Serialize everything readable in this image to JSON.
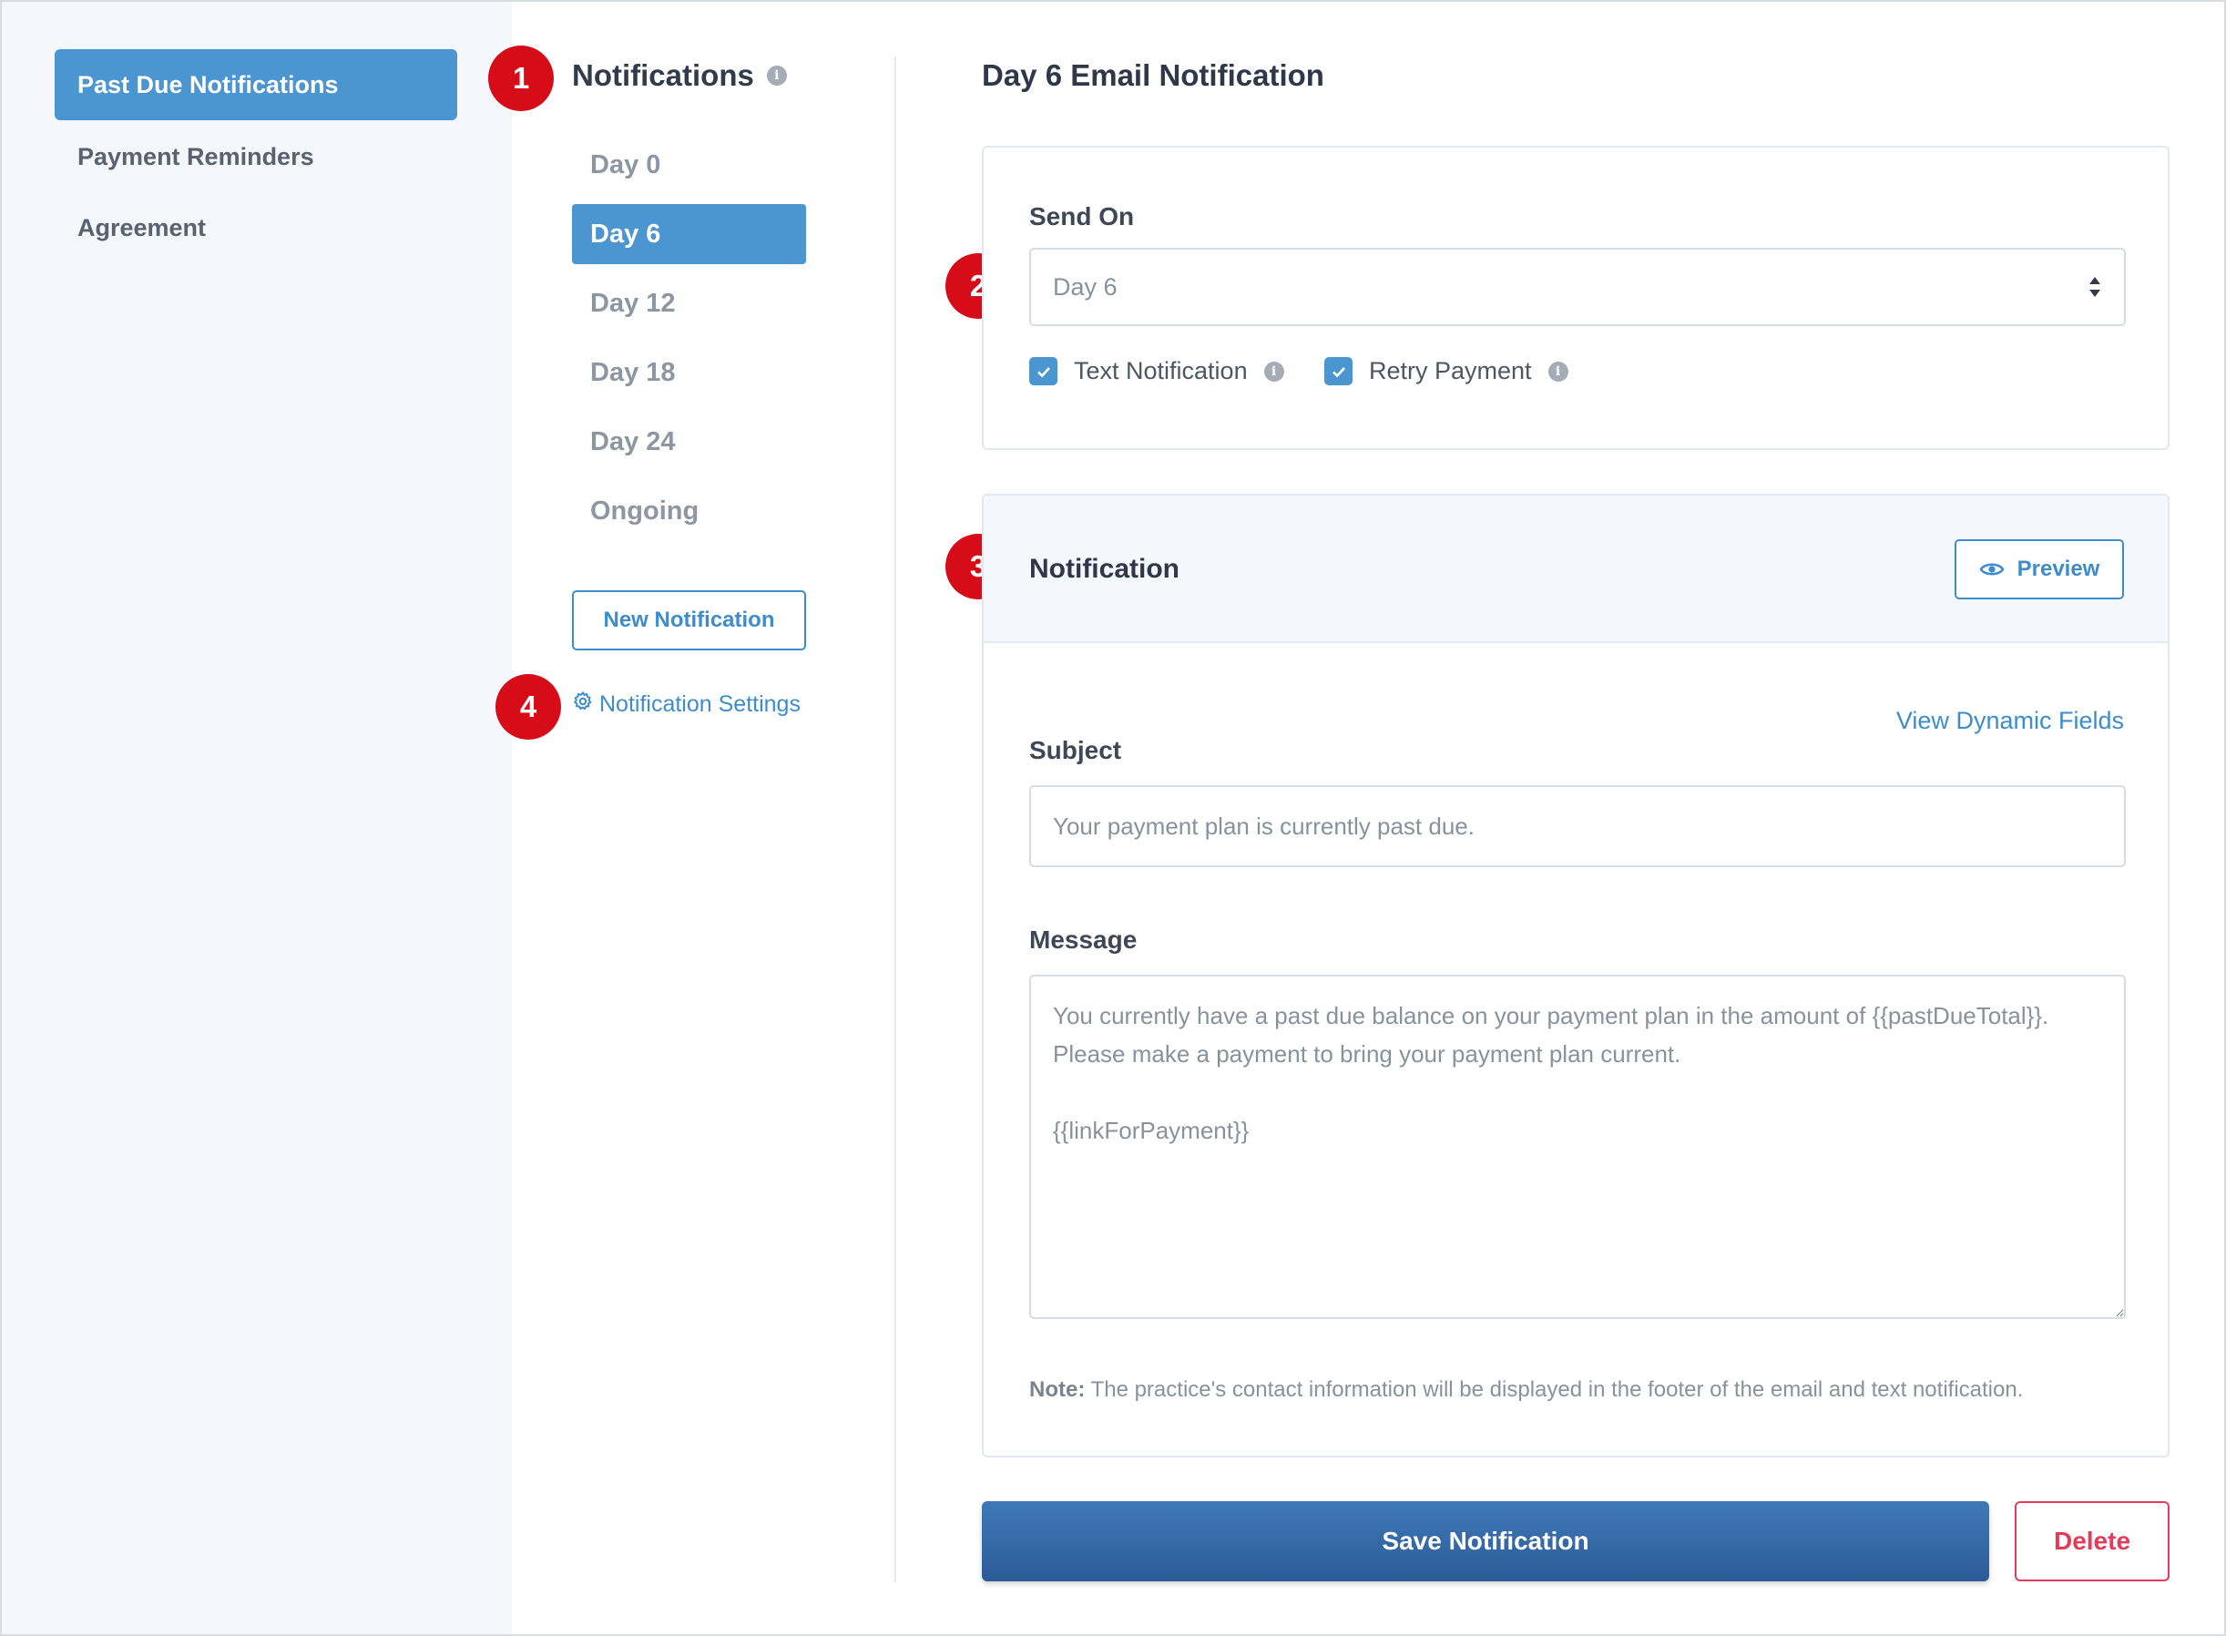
{
  "sidebar": {
    "items": [
      {
        "label": "Past Due Notifications",
        "active": true
      },
      {
        "label": "Payment Reminders",
        "active": false
      },
      {
        "label": "Agreement",
        "active": false
      }
    ]
  },
  "badges": [
    "1",
    "2",
    "3",
    "4"
  ],
  "notifications": {
    "title": "Notifications",
    "days": [
      "Day 0",
      "Day 6",
      "Day 12",
      "Day 18",
      "Day 24",
      "Ongoing"
    ],
    "selected": "Day 6",
    "new_button": "New Notification",
    "settings_link": "Notification Settings"
  },
  "detail": {
    "title": "Day 6 Email Notification",
    "send_on_label": "Send On",
    "send_on_value": "Day 6",
    "text_notification_label": "Text Notification",
    "retry_payment_label": "Retry Payment",
    "notification_header": "Notification",
    "preview_button": "Preview",
    "dynamic_fields_link": "View Dynamic Fields",
    "subject_label": "Subject",
    "subject_value": "Your payment plan is currently past due.",
    "message_label": "Message",
    "message_value": "You currently have a past due balance on your payment plan in the amount of {{pastDueTotal}}.\nPlease make a payment to bring your payment plan current.\n\n{{linkForPayment}}",
    "note_label": "Note:",
    "note_text": " The practice's contact information will be displayed in the footer of the email and text notification.",
    "save_button": "Save Notification",
    "delete_button": "Delete"
  },
  "colors": {
    "accent": "#4b95d1",
    "badge": "#d60c18",
    "save": "#2b5b97",
    "delete": "#e33b5a"
  }
}
